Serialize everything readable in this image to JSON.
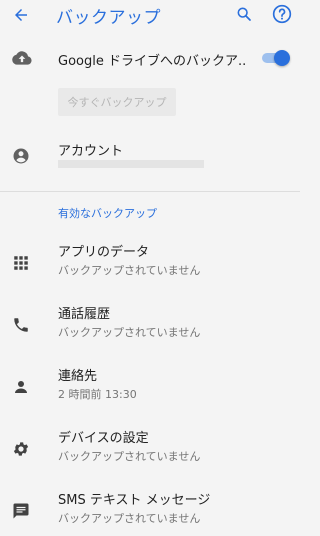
{
  "appbar": {
    "title": "バックアップ",
    "back_icon": "arrow-back-icon",
    "search_icon": "search-icon",
    "help_icon": "help-icon",
    "accent": "#2a6fdc"
  },
  "backup_toggle": {
    "label": "Google ドライブへのバックア..",
    "icon": "cloud-upload-icon",
    "enabled": true
  },
  "backup_now": {
    "label": "今すぐバックアップ"
  },
  "account": {
    "label": "アカウント",
    "icon": "account-circle-icon"
  },
  "section": {
    "title": "有効なバックアップ"
  },
  "items": [
    {
      "title": "アプリのデータ",
      "subtitle": "バックアップされていません",
      "icon": "apps-grid-icon"
    },
    {
      "title": "通話履歴",
      "subtitle": "バックアップされていません",
      "icon": "phone-icon"
    },
    {
      "title": "連絡先",
      "subtitle": "2 時間前 13:30",
      "icon": "person-icon"
    },
    {
      "title": "デバイスの設定",
      "subtitle": "バックアップされていません",
      "icon": "gear-icon"
    },
    {
      "title": "SMS テキスト メッセージ",
      "subtitle": "バックアップされていません",
      "icon": "message-icon"
    }
  ]
}
